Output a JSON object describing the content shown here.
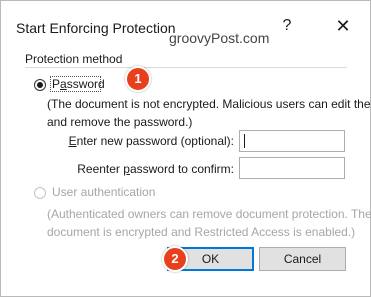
{
  "dialog": {
    "title": "Start Enforcing Protection",
    "help_glyph": "?",
    "close_glyph": "✕"
  },
  "watermark": "groovyPost.com",
  "protection_method": {
    "group_label": "Protection method",
    "password": {
      "label": "Password",
      "selected": true,
      "description_line1": "(The document is not encrypted. Malicious users can edit the file",
      "description_line2": "and remove the password.)",
      "new_password_label": "Enter new password (optional):",
      "new_password_value": "",
      "reenter_label": "Reenter password to confirm:",
      "reenter_value": ""
    },
    "user_authentication": {
      "label": "User authentication",
      "selected": false,
      "enabled": false,
      "description_line1": "(Authenticated owners can remove document protection. The",
      "description_line2": "document is encrypted and Restricted Access is enabled.)"
    }
  },
  "buttons": {
    "ok_label": "OK",
    "cancel_label": "Cancel"
  },
  "annotations": {
    "badge_1": "1",
    "badge_2": "2",
    "badge_color": "#e8401c"
  },
  "colors": {
    "default_button_border": "#0078d7",
    "disabled_text": "#a6a6a6"
  }
}
